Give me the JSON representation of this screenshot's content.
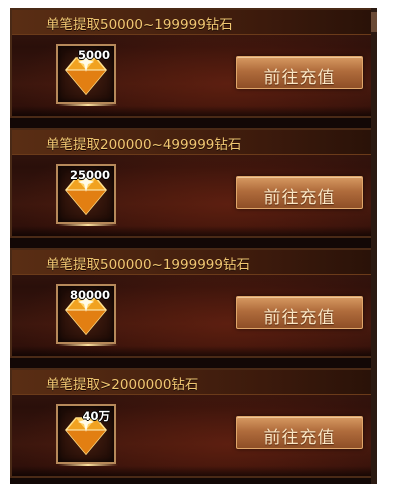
{
  "recharge_tiers": [
    {
      "title": "单笔提取50000~199999钻石",
      "amount": "5000",
      "button_label": "前往充值"
    },
    {
      "title": "单笔提取200000~499999钻石",
      "amount": "25000",
      "button_label": "前往充值"
    },
    {
      "title": "单笔提取500000~1999999钻石",
      "amount": "80000",
      "button_label": "前往充值"
    },
    {
      "title": "单笔提取>2000000钻石",
      "amount": "40万",
      "button_label": "前往充值"
    }
  ],
  "icons": {
    "reward": "diamond-icon"
  },
  "colors": {
    "title_text": "#f0c772",
    "button": "#b06c3c",
    "background": "#2a0f0a"
  }
}
